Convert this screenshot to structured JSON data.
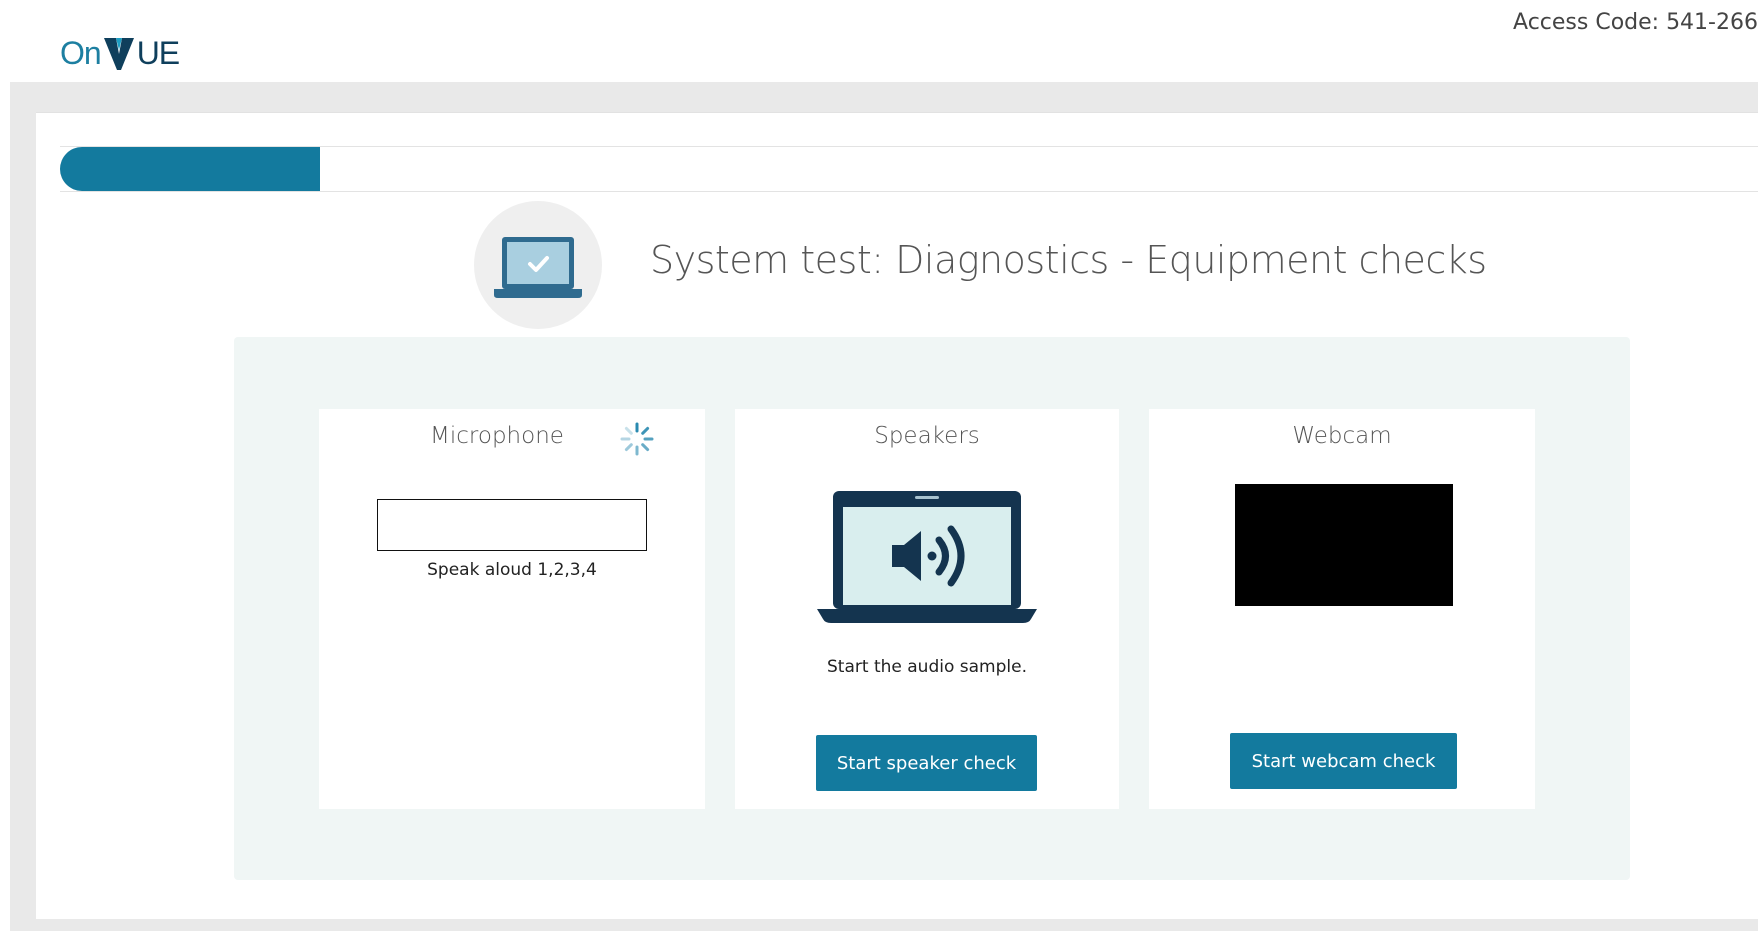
{
  "header": {
    "logo_on": "On",
    "logo_ue": "UE",
    "access_code": "Access Code: 541-266"
  },
  "progress": {
    "fraction": 0.153
  },
  "page": {
    "title": "System test: Diagnostics - Equipment checks"
  },
  "checks": {
    "microphone": {
      "title": "Microphone",
      "hint": "Speak aloud 1,2,3,4"
    },
    "speakers": {
      "title": "Speakers",
      "hint": "Start the audio sample.",
      "button": "Start speaker check"
    },
    "webcam": {
      "title": "Webcam",
      "button": "Start webcam check"
    }
  },
  "colors": {
    "accent": "#137a9e",
    "panel": "#f0f6f5",
    "frame": "#e9e9e9"
  },
  "icons": [
    "laptop-check-icon",
    "loading-spinner-icon",
    "laptop-speaker-icon"
  ]
}
